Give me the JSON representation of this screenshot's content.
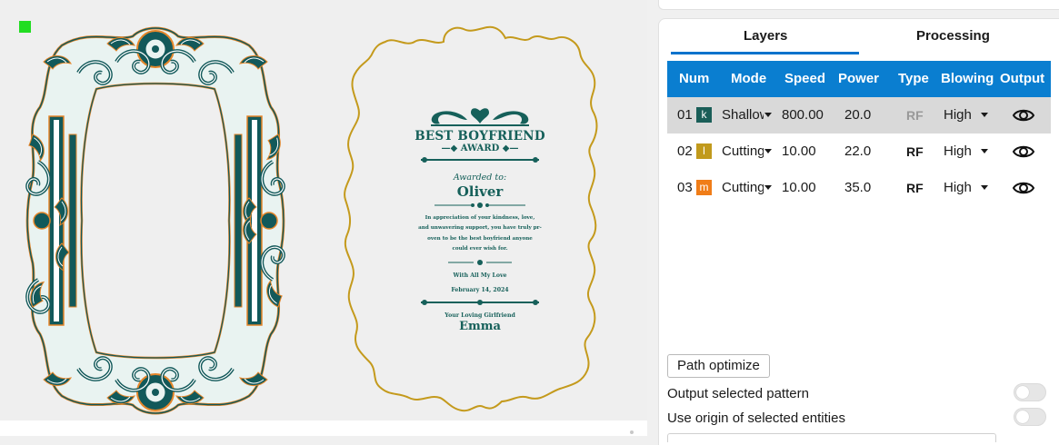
{
  "canvas": {
    "award_card": {
      "title": "BEST BOYFRIEND",
      "subtitle": "AWARD",
      "awarded_to": "Awarded to:",
      "recipient": "Oliver",
      "message_lines": [
        "In appreciation of your kindness, love,",
        "and unwavering support, you have truly pr-",
        "oven to be the best boyfriend anyone",
        "could ever wish for."
      ],
      "sign_off": "With All My Love",
      "date": "February 14, 2024",
      "from_label": "Your Loving Girlfriend",
      "from_name": "Emma"
    },
    "colors": {
      "frame_fill": "#ffffff",
      "frame_ink": "#12595a",
      "frame_outline": "#e5862a",
      "card_outline": "#c49a1c",
      "origin_marker": "#22dd22"
    }
  },
  "panel": {
    "tabs": [
      {
        "label": "Layers",
        "active": true
      },
      {
        "label": "Processing",
        "active": false
      }
    ],
    "table": {
      "headers": [
        "Num",
        "Mode",
        "Speed",
        "Power",
        "Type",
        "Blowing",
        "Output"
      ],
      "rows": [
        {
          "num": "01",
          "swatch_letter": "k",
          "swatch_color": "#1a5e58",
          "mode": "Shallow",
          "speed": "800.00",
          "power": "20.0",
          "type": "RF",
          "type_dim": true,
          "blowing": "High",
          "selected": true
        },
        {
          "num": "02",
          "swatch_letter": "l",
          "swatch_color": "#c19a1c",
          "mode": "Cutting",
          "speed": "10.00",
          "power": "22.0",
          "type": "RF",
          "type_dim": false,
          "blowing": "High",
          "selected": false
        },
        {
          "num": "03",
          "swatch_letter": "m",
          "swatch_color": "#f07d18",
          "mode": "Cutting",
          "speed": "10.00",
          "power": "35.0",
          "type": "RF",
          "type_dim": false,
          "blowing": "High",
          "selected": false
        }
      ]
    },
    "path_optimize_label": "Path optimize",
    "options": [
      {
        "label": "Output selected pattern",
        "enabled": false
      },
      {
        "label": "Use origin of selected entities",
        "enabled": false
      }
    ]
  }
}
